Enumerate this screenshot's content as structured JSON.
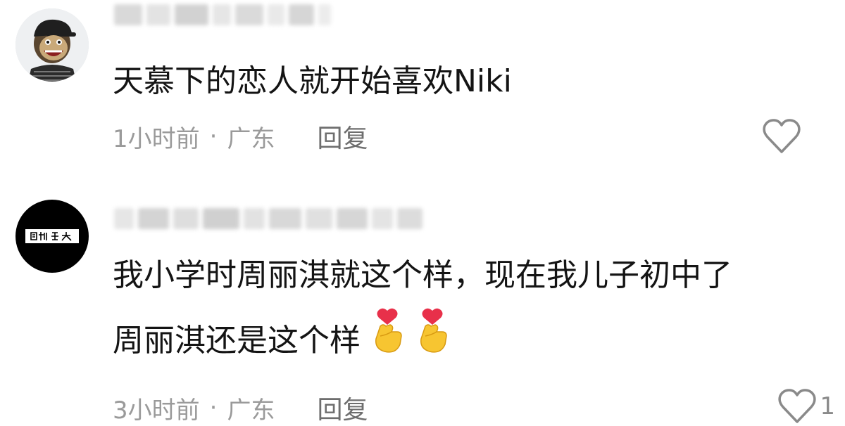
{
  "comments": [
    {
      "avatar_icon": "cartoon-ape-avatar",
      "text_lines": [
        "天慕下的恋人就开始喜欢Niki"
      ],
      "time": "1小时前",
      "separator": "·",
      "location": "广东",
      "reply_label": "回复",
      "like_icon": "heart-outline-icon",
      "like_count": ""
    },
    {
      "avatar_icon": "calligraphy-text-avatar",
      "text_lines": [
        "我小学时周丽淇就这个样，现在我儿子初中了",
        "周丽淇还是这个样"
      ],
      "emoji": [
        "finger-heart-emoji",
        "finger-heart-emoji"
      ],
      "time": "3小时前",
      "separator": "·",
      "location": "广东",
      "reply_label": "回复",
      "like_icon": "heart-outline-icon",
      "like_count": "1"
    }
  ],
  "colors": {
    "text": "#141414",
    "meta": "#9a9a9a",
    "reply": "#6e6e6e",
    "background": "#ffffff"
  }
}
